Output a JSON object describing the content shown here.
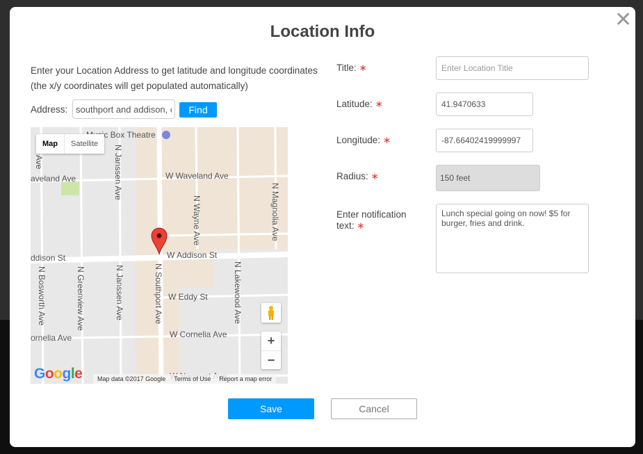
{
  "modal": {
    "title": "Location Info",
    "close_icon": "close-x-icon",
    "intro": "Enter your Location Address to get latitude and longitude coordinates (the x/y coordinates will get populated automatically)",
    "address_label": "Address:",
    "address_value": "southport and addison, c",
    "find_label": "Find"
  },
  "map": {
    "type_map": "Map",
    "type_satellite": "Satellite",
    "zoom_in": "+",
    "zoom_out": "−",
    "logo": "Google",
    "attribution": [
      "Map data ©2017 Google",
      "Terms of Use",
      "Report a map error"
    ],
    "labels": {
      "music_box": "Music Box Theatre",
      "waveland_w": "aveland Ave",
      "waveland": "W Waveland Ave",
      "addison_w": "ddison St",
      "addison": "W Addison St",
      "eddy": "W Eddy St",
      "cornelia_w": "ornelia Ave",
      "cornelia": "W Cornelia Ave",
      "newport": "W Newport Ave",
      "bosworth_top": "Ave",
      "bosworth": "N Bosworth Ave",
      "greenview": "N Greenview Ave",
      "janssen_top": "N Janssen Ave",
      "janssen": "N Janssen Ave",
      "southport": "N Southport Ave",
      "wayne": "N Wayne Ave",
      "lakewood": "N Lakewood Ave",
      "magnolia": "N Magnolia Ave"
    },
    "marker_color": "#ea4335"
  },
  "form": {
    "title_label": "Title:",
    "title_placeholder": "Enter Location Title",
    "latitude_label": "Latitude:",
    "latitude_value": "41.9470633",
    "longitude_label": "Longitude:",
    "longitude_value": "-87.66402419999997",
    "radius_label": "Radius:",
    "radius_value": "150 feet",
    "notification_label_1": "Enter notification",
    "notification_label_2": "text:",
    "notification_value": "Lunch special going on now! $5 for burger, fries and drink.",
    "required_mark": "∗"
  },
  "buttons": {
    "save": "Save",
    "cancel": "Cancel"
  },
  "colors": {
    "accent": "#0099ff",
    "required": "#e53935"
  }
}
